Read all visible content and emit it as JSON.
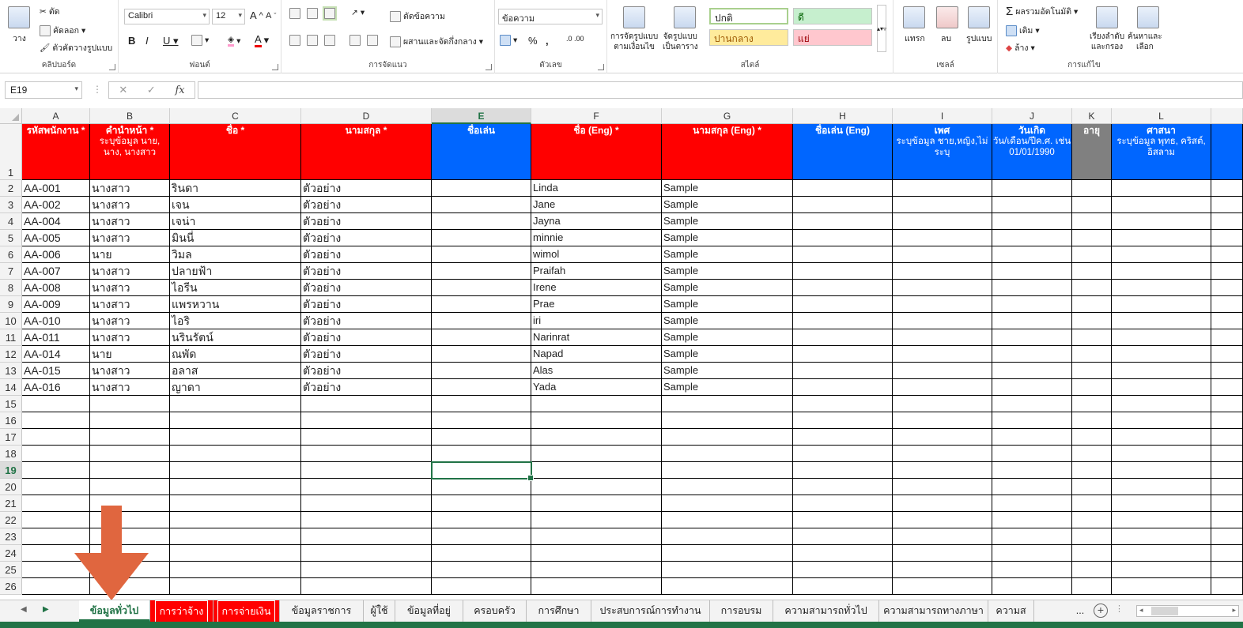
{
  "ribbon": {
    "clipboard": {
      "label": "คลิปบอร์ด",
      "paste": "วาง",
      "cut": "ตัด",
      "copy": "คัดลอก",
      "format_painter": "ตัวคัดวางรูปแบบ"
    },
    "font": {
      "label": "ฟอนต์",
      "name": "Calibri",
      "size": "12"
    },
    "alignment": {
      "label": "การจัดแนว",
      "wrap": "ตัดข้อความ",
      "merge": "ผสานและจัดกึ่งกลาง"
    },
    "number": {
      "label": "ตัวเลข",
      "format": "ข้อความ"
    },
    "styles": {
      "label": "สไตล์",
      "conditional": "การจัดรูปแบบ\nตามเงื่อนไข",
      "as_table": "จัดรูปแบบ\nเป็นตาราง",
      "normal": "ปกติ",
      "good": "ดี",
      "neutral": "ปานกลาง",
      "bad": "แย่"
    },
    "cells": {
      "label": "เซลล์",
      "insert": "แทรก",
      "delete": "ลบ",
      "format": "รูปแบบ"
    },
    "editing": {
      "label": "การแก้ไข",
      "autosum": "ผลรวมอัตโนมัติ",
      "fill": "เติม",
      "clear": "ล้าง",
      "sort": "เรียงลำดับ\nและกรอง",
      "find": "ค้นหาและ\nเลือก"
    }
  },
  "formula_bar": {
    "name_box": "E19",
    "fx": "fx",
    "cancel": "✕",
    "enter": "✓",
    "value": ""
  },
  "columns": [
    {
      "letter": "A"
    },
    {
      "letter": "B"
    },
    {
      "letter": "C"
    },
    {
      "letter": "D"
    },
    {
      "letter": "E"
    },
    {
      "letter": "F"
    },
    {
      "letter": "G"
    },
    {
      "letter": "H"
    },
    {
      "letter": "I"
    },
    {
      "letter": "J"
    },
    {
      "letter": "K"
    },
    {
      "letter": "L"
    }
  ],
  "headers": [
    {
      "title": "รหัสพนักงาน *",
      "sub": "",
      "color": "red"
    },
    {
      "title": "คำนำหน้า *",
      "sub": "ระบุข้อมูล นาย, นาง, นางสาว",
      "color": "red"
    },
    {
      "title": "ชื่อ *",
      "sub": "",
      "color": "red"
    },
    {
      "title": "นามสกุล *",
      "sub": "",
      "color": "red"
    },
    {
      "title": "ชื่อเล่น",
      "sub": "",
      "color": "blue"
    },
    {
      "title": "ชื่อ (Eng) *",
      "sub": "",
      "color": "red"
    },
    {
      "title": "นามสกุล (Eng) *",
      "sub": "",
      "color": "red"
    },
    {
      "title": "ชื่อเล่น (Eng)",
      "sub": "",
      "color": "blue"
    },
    {
      "title": "เพศ",
      "sub": "ระบุข้อมูล ชาย,หญิง,ไม่ระบุ",
      "color": "blue"
    },
    {
      "title": "วันเกิด",
      "sub": "วัน/เดือน/ปีค.ศ. เช่น 01/01/1990",
      "color": "blue"
    },
    {
      "title": "อายุ",
      "sub": "",
      "color": "gray"
    },
    {
      "title": "ศาสนา",
      "sub": "ระบุข้อมูล พุทธ, คริสต์, อิสลาม",
      "color": "blue"
    }
  ],
  "rows": [
    [
      "AA-001",
      "นางสาว",
      "รินดา",
      "ตัวอย่าง",
      "",
      "Linda",
      "Sample"
    ],
    [
      "AA-002",
      "นางสาว",
      "เจน",
      "ตัวอย่าง",
      "",
      "Jane",
      "Sample"
    ],
    [
      "AA-004",
      "นางสาว",
      "เจน่า",
      "ตัวอย่าง",
      "",
      "Jayna",
      "Sample"
    ],
    [
      "AA-005",
      "นางสาว",
      "มินนี่",
      "ตัวอย่าง",
      "",
      "minnie",
      "Sample"
    ],
    [
      "AA-006",
      "นาย",
      "วิมล",
      "ตัวอย่าง",
      "",
      "wimol",
      "Sample"
    ],
    [
      "AA-007",
      "นางสาว",
      "ปลายฟ้า",
      "ตัวอย่าง",
      "",
      "Praifah",
      "Sample"
    ],
    [
      "AA-008",
      "นางสาว",
      "ไอรีน",
      "ตัวอย่าง",
      "",
      "Irene",
      "Sample"
    ],
    [
      "AA-009",
      "นางสาว",
      "แพรหวาน",
      "ตัวอย่าง",
      "",
      "Prae",
      "Sample"
    ],
    [
      "AA-010",
      "นางสาว",
      "ไอริ",
      "ตัวอย่าง",
      "",
      "iri",
      "Sample"
    ],
    [
      "AA-011",
      "นางสาว",
      "นรินรัตน์",
      "ตัวอย่าง",
      "",
      "Narinrat",
      "Sample"
    ],
    [
      "AA-014",
      "นาย",
      "ณพัด",
      "ตัวอย่าง",
      "",
      "Napad",
      "Sample"
    ],
    [
      "AA-015",
      "นางสาว",
      "อลาส",
      "ตัวอย่าง",
      "",
      "Alas",
      "Sample"
    ],
    [
      "AA-016",
      "นางสาว",
      "ญาดา",
      "ตัวอย่าง",
      "",
      "Yada",
      "Sample"
    ]
  ],
  "row_numbers": [
    "1",
    "2",
    "3",
    "4",
    "5",
    "6",
    "7",
    "8",
    "9",
    "10",
    "11",
    "12",
    "13",
    "14",
    "15",
    "16",
    "17",
    "18",
    "19",
    "20",
    "21",
    "22",
    "23",
    "24",
    "25",
    "26"
  ],
  "selected_row": "19",
  "sheet_tabs": [
    {
      "label": "ข้อมูลทั่วไป",
      "state": "active"
    },
    {
      "label": "การว่าจ้าง",
      "state": "red"
    },
    {
      "label": "การจ่ายเงิน",
      "state": "red"
    },
    {
      "label": "ข้อมูลราชการ",
      "state": "normal"
    },
    {
      "label": "ผู้ใช้",
      "state": "normal"
    },
    {
      "label": "ข้อมูลที่อยู่",
      "state": "normal"
    },
    {
      "label": "ครอบครัว",
      "state": "normal"
    },
    {
      "label": "การศึกษา",
      "state": "normal"
    },
    {
      "label": "ประสบการณ์การทำงาน",
      "state": "normal"
    },
    {
      "label": "การอบรม",
      "state": "normal"
    },
    {
      "label": "ความสามารถทั่วไป",
      "state": "normal"
    },
    {
      "label": "ความสามารถทางภาษา",
      "state": "normal"
    },
    {
      "label": "ความส",
      "state": "normal"
    }
  ],
  "tab_more": "...",
  "colors": {
    "accent": "#217346",
    "required_header": "#ff0000",
    "optional_header": "#0066ff",
    "computed_header": "#808080",
    "annotation_arrow": "#e0663f"
  }
}
